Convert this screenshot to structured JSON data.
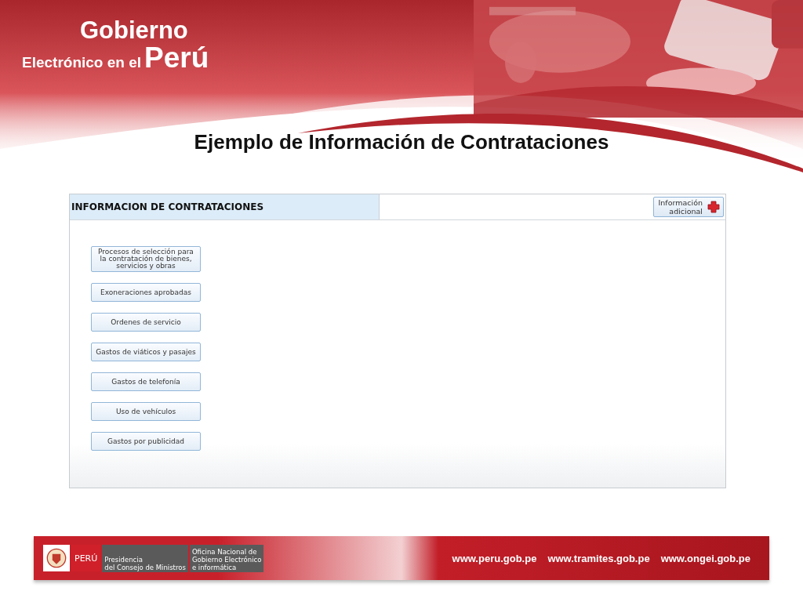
{
  "logo": {
    "line_1": "Gobierno",
    "line_2": "Electrónico en el",
    "line_3": "Perú"
  },
  "title": "Ejemplo de Información de Contrataciones",
  "panel": {
    "heading": "INFORMACION DE CONTRATACIONES",
    "info_button": "Información\nadicional",
    "buttons": [
      "Procesos de selección para\nla contratación de bienes,\nservicios y obras",
      "Exoneraciones aprobadas",
      "Ordenes de servicio",
      "Gastos de viáticos y pasajes",
      "Gastos de telefonía",
      "Uso de vehículos",
      "Gastos por publicidad"
    ]
  },
  "footer": {
    "country": "PERÚ",
    "ministry": "Presidencia\ndel Consejo de Ministros",
    "office": "Oficina Nacional de\nGobierno Electrónico\ne informática",
    "links": [
      "www.peru.gob.pe",
      "www.tramites.gob.pe",
      "www.ongei.gob.pe"
    ]
  }
}
